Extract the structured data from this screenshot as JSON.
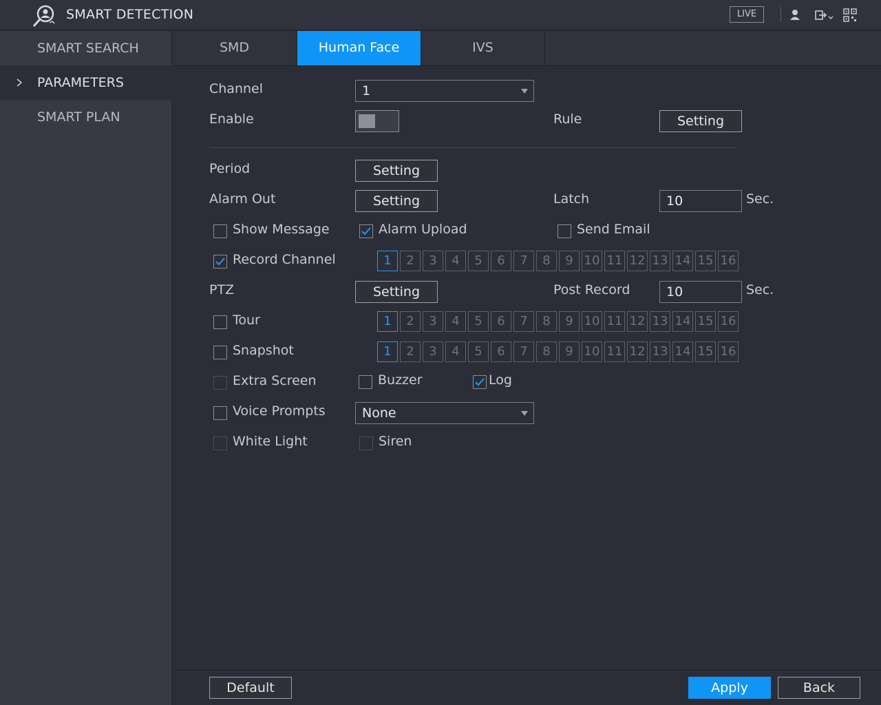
{
  "header": {
    "title": "SMART DETECTION",
    "live_label": "LIVE",
    "icons": [
      "smart-detection-logo-icon",
      "user-icon",
      "logout-icon",
      "qr-code-icon"
    ]
  },
  "sidebar": {
    "items": [
      {
        "label": "SMART SEARCH",
        "active": false
      },
      {
        "label": "PARAMETERS",
        "active": true
      },
      {
        "label": "SMART PLAN",
        "active": false
      }
    ]
  },
  "tabs": [
    {
      "label": "SMD",
      "active": false
    },
    {
      "label": "Human Face",
      "active": true
    },
    {
      "label": "IVS",
      "active": false
    }
  ],
  "form": {
    "channel_label": "Channel",
    "channel_value": "1",
    "enable_label": "Enable",
    "enable_on": false,
    "rule_label": "Rule",
    "rule_button": "Setting",
    "period_label": "Period",
    "period_button": "Setting",
    "alarm_out_label": "Alarm Out",
    "alarm_out_button": "Setting",
    "latch_label": "Latch",
    "latch_value": "10",
    "latch_unit": "Sec.",
    "show_message": {
      "label": "Show Message",
      "checked": false
    },
    "alarm_upload": {
      "label": "Alarm Upload",
      "checked": true
    },
    "send_email": {
      "label": "Send Email",
      "checked": false
    },
    "record_channel": {
      "label": "Record Channel",
      "checked": true
    },
    "ptz_label": "PTZ",
    "ptz_button": "Setting",
    "post_record_label": "Post Record",
    "post_record_value": "10",
    "post_record_unit": "Sec.",
    "tour": {
      "label": "Tour",
      "checked": false
    },
    "snapshot": {
      "label": "Snapshot",
      "checked": false
    },
    "extra_screen": {
      "label": "Extra Screen",
      "checked": false,
      "disabled": true
    },
    "buzzer": {
      "label": "Buzzer",
      "checked": false
    },
    "log": {
      "label": "Log",
      "checked": true
    },
    "voice_prompts": {
      "label": "Voice Prompts",
      "checked": false
    },
    "voice_prompts_value": "None",
    "white_light": {
      "label": "White Light",
      "checked": false,
      "disabled": true
    },
    "siren": {
      "label": "Siren",
      "checked": false,
      "disabled": true
    },
    "channels": [
      "1",
      "2",
      "3",
      "4",
      "5",
      "6",
      "7",
      "8",
      "9",
      "10",
      "11",
      "12",
      "13",
      "14",
      "15",
      "16"
    ],
    "record_selected": [
      "1"
    ],
    "tour_selected": [
      "1"
    ],
    "snapshot_selected": [
      "1"
    ]
  },
  "footer": {
    "default_label": "Default",
    "apply_label": "Apply",
    "back_label": "Back"
  },
  "colors": {
    "accent": "#0e95f5",
    "background": "#2b2e38",
    "sidebar": "#373a44"
  }
}
